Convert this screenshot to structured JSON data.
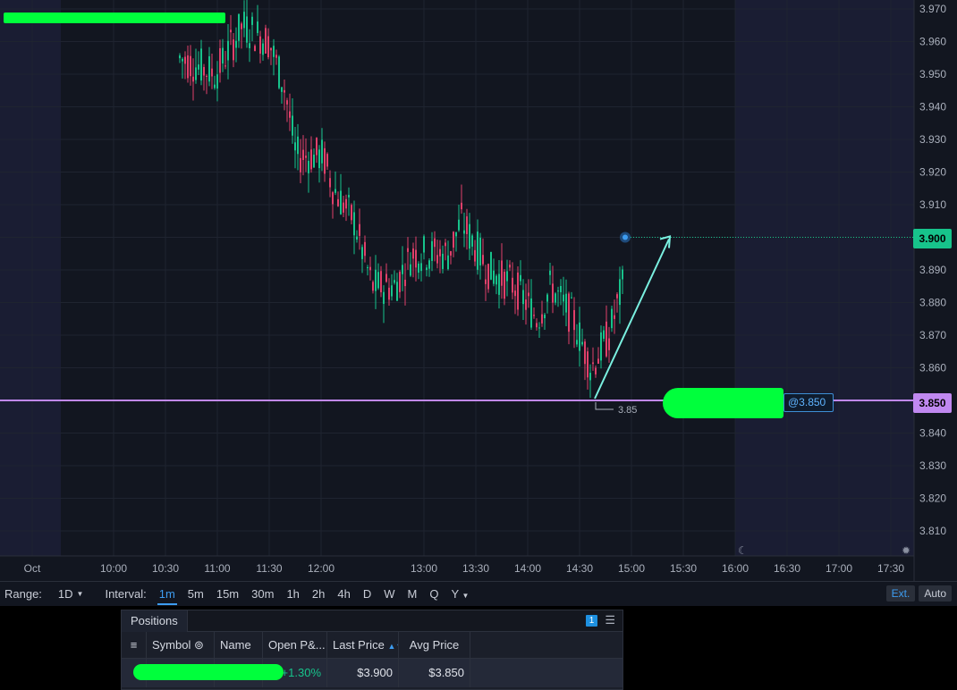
{
  "chart": {
    "price_ticks": [
      "3.970",
      "3.960",
      "3.950",
      "3.940",
      "3.930",
      "3.920",
      "3.910",
      "3.900",
      "3.890",
      "3.880",
      "3.870",
      "3.860",
      "3.850",
      "3.840",
      "3.830",
      "3.820",
      "3.810"
    ],
    "time_ticks": [
      "Oct",
      "10:00",
      "10:30",
      "11:00",
      "11:30",
      "12:00",
      "13:00",
      "13:30",
      "14:00",
      "14:30",
      "15:00",
      "15:30",
      "16:00",
      "16:30",
      "17:00",
      "17:30"
    ],
    "last_price_tag": "3.900",
    "avg_price_tag": "3.850",
    "order_label": "@3.850",
    "low_marker_label": "3.85",
    "colors": {
      "up": "#17c38b",
      "down": "#e0406a",
      "avg_line": "#c088f0",
      "arrow": "#7af0e0",
      "background": "#121620",
      "extended_hours": "#1a1d33"
    }
  },
  "toolbar": {
    "range_label": "Range:",
    "range_value": "1D",
    "interval_label": "Interval:",
    "intervals": [
      "1m",
      "5m",
      "15m",
      "30m",
      "1h",
      "2h",
      "4h",
      "D",
      "W",
      "M",
      "Q",
      "Y"
    ],
    "active_interval": "1m",
    "ext_button": "Ext.",
    "auto_button": "Auto"
  },
  "positions": {
    "tab_label": "Positions",
    "count": "1",
    "columns": [
      "Symbol",
      "Name",
      "Open P&...",
      "Last Price",
      "Avg Price"
    ],
    "row": {
      "open_pnl": "+1.30%",
      "last_price": "$3.900",
      "avg_price": "$3.850"
    }
  }
}
